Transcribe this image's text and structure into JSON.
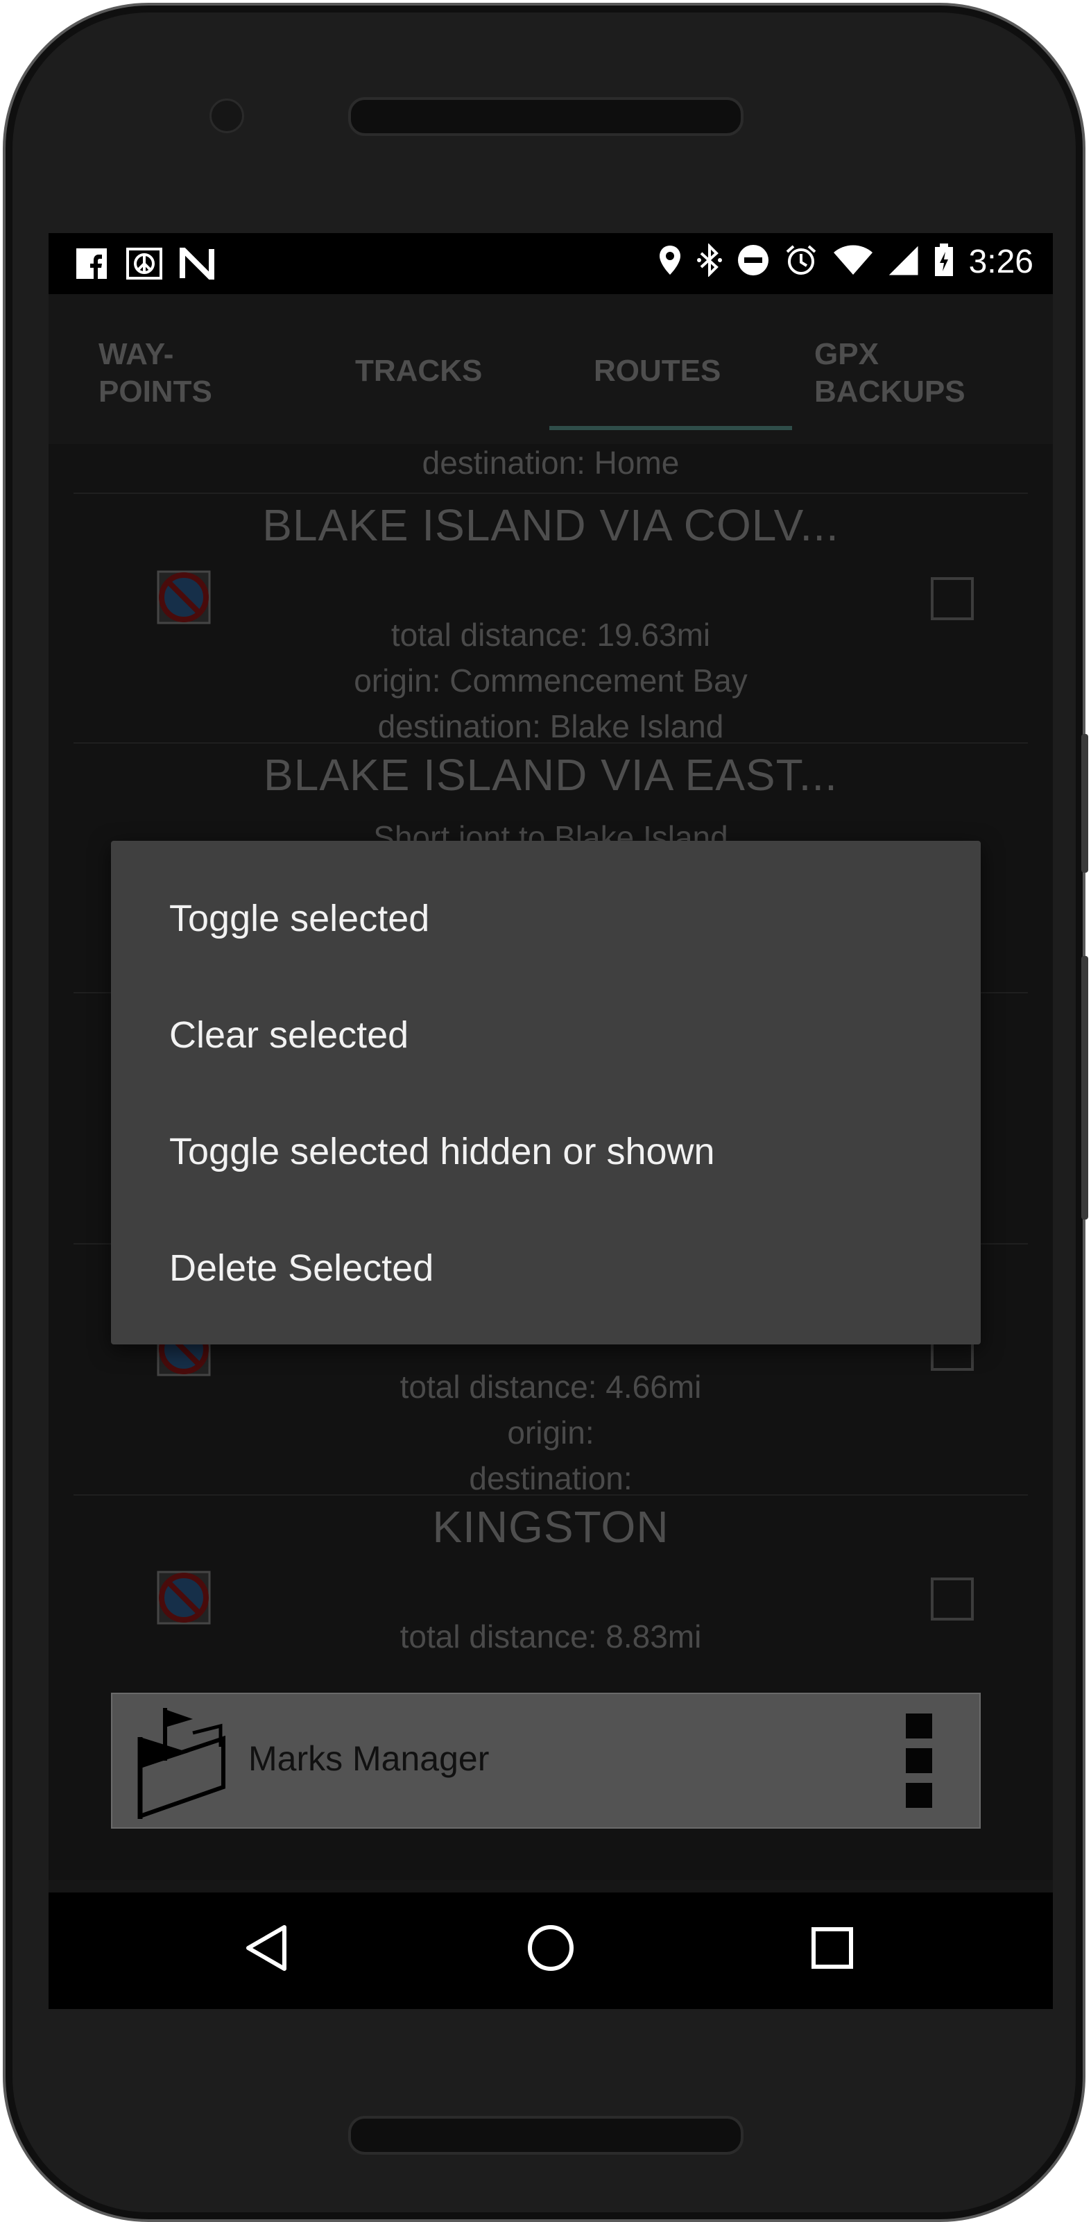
{
  "statusbar": {
    "time": "3:26",
    "left_icons": [
      "facebook-icon",
      "peace-icon",
      "n-icon"
    ],
    "right_icons": [
      "location-icon",
      "bluetooth-icon",
      "dnd-icon",
      "alarm-icon",
      "wifi-icon",
      "signal-icon",
      "battery-icon"
    ]
  },
  "tabs": [
    {
      "line1": "WAY-",
      "line2": "POINTS"
    },
    {
      "line1": "TRACKS",
      "line2": ""
    },
    {
      "line1": "ROUTES",
      "line2": ""
    },
    {
      "line1": "GPX",
      "line2": "BACKUPS"
    }
  ],
  "routes": {
    "top_fragment": "destination: Home",
    "r1": {
      "title": "BLAKE ISLAND VIA COLV...",
      "distance": "total distance: 19.63mi",
      "origin": "origin: Commencement Bay",
      "destination": "destination: Blake Island"
    },
    "r2": {
      "title": "BLAKE ISLAND VIA EAST...",
      "description": "Short jont to Blake Island"
    },
    "r3": {
      "distance": "total distance: 4.66mi",
      "origin": "origin:",
      "destination": "destination:"
    },
    "r4": {
      "title": "KINGSTON",
      "distance": "total distance: 8.83mi"
    }
  },
  "dialog": {
    "items": [
      "Toggle selected",
      "Clear selected",
      "Toggle selected hidden or shown",
      "Delete Selected"
    ]
  },
  "marks_bar": {
    "label": "Marks Manager"
  },
  "colors": {
    "screen_bg": "#161616",
    "dialog_bg": "#404040",
    "tab_indicator": "#3a5f5a",
    "marks_bar_bg": "#535353"
  }
}
